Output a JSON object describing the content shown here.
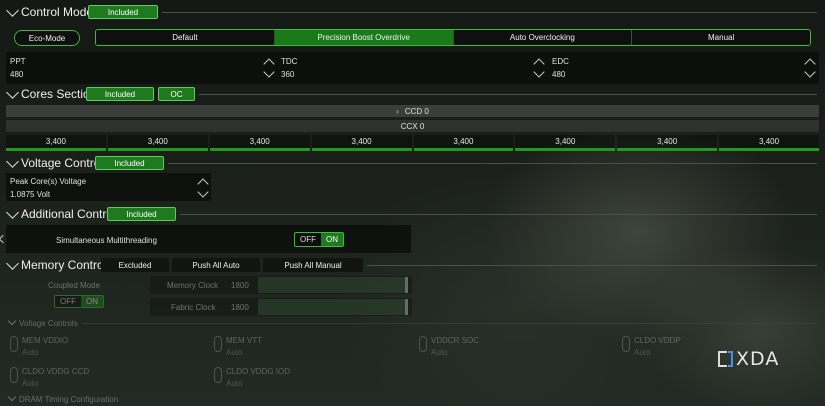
{
  "control_mode": {
    "title": "Control Mode",
    "badge": "Included",
    "eco_mode": "Eco-Mode",
    "modes": [
      {
        "label": "Default",
        "active": false
      },
      {
        "label": "Precision Boost Overdrive",
        "active": true
      },
      {
        "label": "Auto Overclocking",
        "active": false
      },
      {
        "label": "Manual",
        "active": false
      }
    ],
    "limits": [
      {
        "label": "PPT",
        "value": "480"
      },
      {
        "label": "TDC",
        "value": "360"
      },
      {
        "label": "EDC",
        "value": "480"
      }
    ]
  },
  "cores_section": {
    "title": "Cores Section",
    "badge": "Included",
    "oc_badge": "OC",
    "ccd": "CCD 0",
    "ccx": "CCX 0",
    "frequencies": [
      "3,400",
      "3,400",
      "3,400",
      "3,400",
      "3,400",
      "3,400",
      "3,400",
      "3,400"
    ]
  },
  "voltage_control": {
    "title": "Voltage Control",
    "badge": "Included",
    "peak_label": "Peak Core(s) Voltage",
    "peak_value": "1.0875 Volt"
  },
  "additional_control": {
    "title": "Additional Control",
    "badge": "Included",
    "smt_label": "Simultaneous Multithreading",
    "toggle_off": "OFF",
    "toggle_on": "ON"
  },
  "memory_control": {
    "title": "Memory Control",
    "tabs": [
      "Excluded",
      "Push All Auto",
      "Push All Manual"
    ],
    "coupled_mode": "Coupled Mode",
    "toggle_off": "OFF",
    "toggle_on": "ON",
    "memory_clock_label": "Memory Clock",
    "memory_clock_value": "1800",
    "fabric_clock_label": "Fabric Clock",
    "fabric_clock_value": "1800"
  },
  "voltage_controls": {
    "title": "Voltage Controls",
    "items": [
      {
        "name": "MEM VDDIO",
        "value": "Auto"
      },
      {
        "name": "MEM VTT",
        "value": "Auto"
      },
      {
        "name": "VDDCR SOC",
        "value": "Auto"
      },
      {
        "name": "CLDO VDDP",
        "value": "Auto"
      },
      {
        "name": "CLDO VDDG CCD",
        "value": "Auto"
      },
      {
        "name": "CLDO VDDG IOD",
        "value": "Auto"
      }
    ]
  },
  "dram_timing": {
    "title": "DRAM Timing Configuration"
  },
  "watermark": {
    "text": "XDA"
  }
}
